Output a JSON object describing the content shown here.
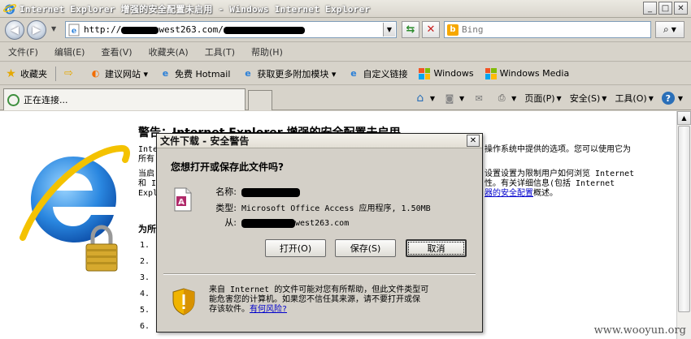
{
  "window": {
    "title": "Internet Explorer 增强的安全配置未启用 - Windows Internet Explorer",
    "minimize": "_",
    "maximize": "□",
    "close": "✕"
  },
  "address": {
    "prefix": "http://",
    "middle": "west263.com/",
    "dropdown": "▼"
  },
  "search": {
    "placeholder": "Bing",
    "button": "⌕"
  },
  "menu": [
    "文件(F)",
    "编辑(E)",
    "查看(V)",
    "收藏夹(A)",
    "工具(T)",
    "帮助(H)"
  ],
  "favorites": {
    "label": "收藏夹",
    "items": [
      "建议网站 ▾",
      "免费 Hotmail",
      "获取更多附加模块 ▾",
      "自定义链接",
      "Windows",
      "Windows Media"
    ]
  },
  "tab": {
    "label": "正在连接..."
  },
  "commandbar": {
    "page": "页面(P)",
    "safety": "安全(S)",
    "tools": "工具(O)"
  },
  "content": {
    "heading_prefix": "警告：",
    "heading_struck": "Internet Explorer 增强的安全配置未启用",
    "left_lines": [
      "Inte",
      "所有",
      "当启",
      "和 I",
      "Explo"
    ],
    "right_line1": "操作系统中提供的选项。您可以使用它为",
    "right_line2": "设置设置为限制用户如何浏览 Internet",
    "right_line3": "性。有关详细信息(包括 Internet",
    "right_line4_link": "器的安全配置",
    "right_line4_tail": "概述。",
    "section_label": "为所",
    "list_numbers": [
      "1.",
      "2.",
      "3.",
      "4.",
      "5.",
      "6."
    ]
  },
  "dialog": {
    "title": "文件下载 - 安全警告",
    "question": "您想打开或保存此文件吗?",
    "name_label": "名称:",
    "type_label": "类型:",
    "type_value": "Microsoft Office Access 应用程序, 1.50MB",
    "from_label": "从:",
    "from_value": "west263.com",
    "open_button": "打开(O)",
    "save_button": "保存(S)",
    "cancel_button": "取消",
    "note_line1": "来自 Internet 的文件可能对您有所帮助，但此文件类型可",
    "note_line2": "能危害您的计算机。如果您不信任其来源，请不要打开或保",
    "note_line3": "存该软件。",
    "note_link": "有何风险?"
  },
  "watermark": "www.wooyun.org"
}
